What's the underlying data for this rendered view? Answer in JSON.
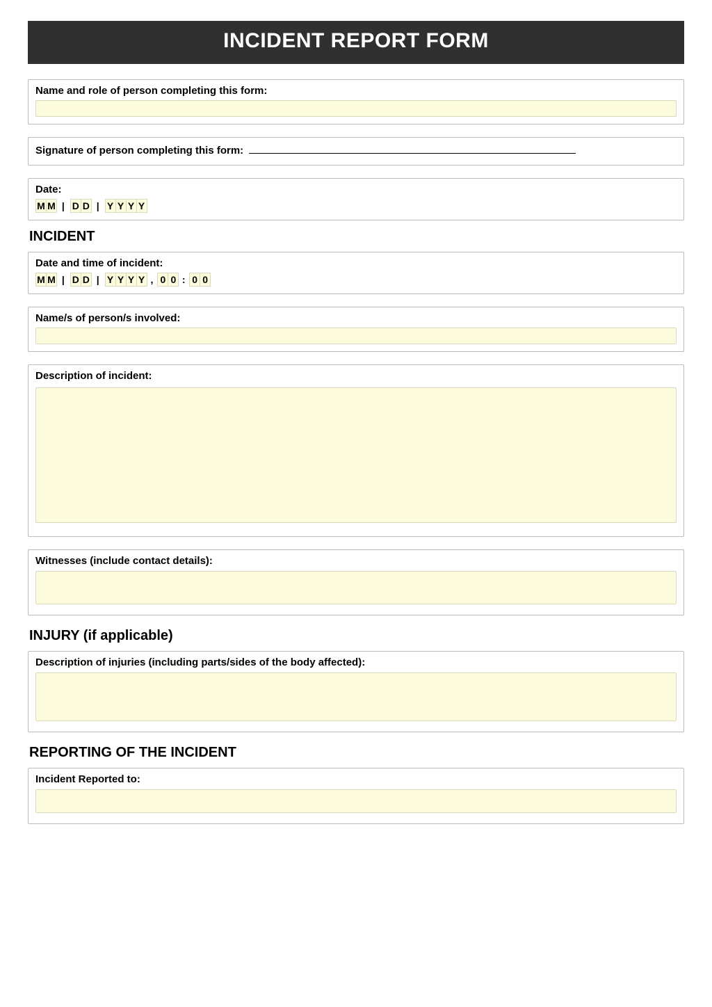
{
  "title": "INCIDENT REPORT FORM",
  "fields": {
    "name_role_label": "Name and role of person completing this form:",
    "signature_label": "Signature of person completing this form:",
    "date_label": "Date:",
    "date_placeholder": {
      "m": "M",
      "d": "D",
      "y": "Y",
      "sep": "|"
    }
  },
  "incident": {
    "heading": "INCIDENT",
    "datetime_label": "Date and time of incident:",
    "time": {
      "h": "0",
      "m": "0",
      "colon": ":",
      "comma": ","
    },
    "persons_label": "Name/s of person/s involved:",
    "description_label": "Description of incident:",
    "witnesses_label": "Witnesses (include contact details):"
  },
  "injury": {
    "heading": "INJURY (if applicable)",
    "description_label": "Description of injuries (including parts/sides of the body affected):"
  },
  "reporting": {
    "heading": "REPORTING OF THE INCIDENT",
    "reported_to_label": "Incident Reported to:"
  }
}
